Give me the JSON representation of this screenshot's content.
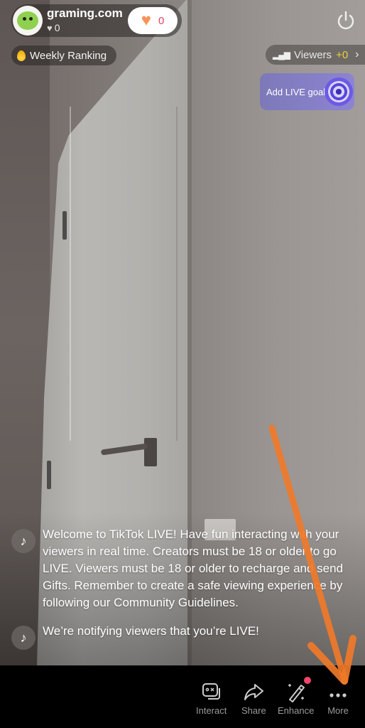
{
  "host": {
    "name": "graming.com",
    "likes": "0",
    "follow_count": "0"
  },
  "ranking": {
    "label": "Weekly Ranking"
  },
  "viewers": {
    "label": "Viewers",
    "delta": "+0"
  },
  "goal": {
    "label": "Add LIVE goal"
  },
  "chat": [
    {
      "icon": "tiktok-icon",
      "text": "Welcome to TikTok LIVE! Have fun interacting with your viewers in real time. Creators must be 18 or older to go LIVE. Viewers must be 18 or older to recharge and send Gifts. Remember to create a safe viewing experience by following our Community Guidelines."
    },
    {
      "icon": "tiktok-icon",
      "text": "We’re notifying viewers that you’re LIVE!"
    }
  ],
  "toolbar": {
    "items": [
      {
        "label": "Interact",
        "icon": "interact-icon"
      },
      {
        "label": "Share",
        "icon": "share-icon"
      },
      {
        "label": "Enhance",
        "icon": "magic-wand-icon",
        "badge": true
      },
      {
        "label": "More",
        "icon": "more-dots-icon"
      }
    ]
  },
  "colors": {
    "annotation_arrow": "#f07a2a",
    "viewer_delta": "#e8d53c",
    "goal_bg": "#8580c6",
    "badge": "#f2456a"
  }
}
